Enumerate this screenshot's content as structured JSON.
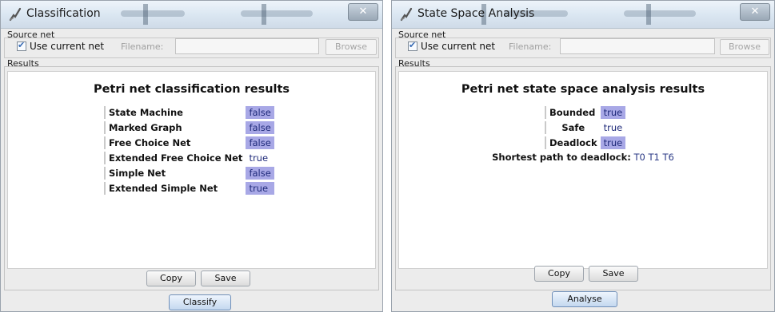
{
  "windows": [
    {
      "title": "Classification",
      "source_label": "Source net",
      "use_current_label": "Use current net",
      "use_current_checked": true,
      "filename_label": "Filename:",
      "filename_value": "",
      "browse_label": "Browse",
      "results_label": "Results",
      "results_title": "Petri net classification results",
      "rows": [
        {
          "label": "State Machine",
          "value": "false"
        },
        {
          "label": "Marked Graph",
          "value": "false"
        },
        {
          "label": "Free Choice Net",
          "value": "false"
        },
        {
          "label": "Extended Free Choice Net",
          "value": "true"
        },
        {
          "label": "Simple Net",
          "value": "false"
        },
        {
          "label": "Extended Simple Net",
          "value": "true"
        }
      ],
      "copy_label": "Copy",
      "save_label": "Save",
      "action_label": "Classify"
    },
    {
      "title": "State Space Analysis",
      "source_label": "Source net",
      "use_current_label": "Use current net",
      "use_current_checked": true,
      "filename_label": "Filename:",
      "filename_value": "",
      "browse_label": "Browse",
      "results_label": "Results",
      "results_title": "Petri net state space analysis results",
      "rows": [
        {
          "label": "Bounded",
          "value": "true"
        },
        {
          "label": "Safe",
          "value": "true"
        },
        {
          "label": "Deadlock",
          "value": "true"
        }
      ],
      "path_label": "Shortest path to deadlock:",
      "path_value": "T0 T1 T6",
      "copy_label": "Copy",
      "save_label": "Save",
      "action_label": "Analyse"
    }
  ],
  "colors": {
    "highlight": "#a8a8e6",
    "value_text": "#1f2a7a",
    "window_bg": "#ececec",
    "titlebar": "#dbe7f2"
  }
}
